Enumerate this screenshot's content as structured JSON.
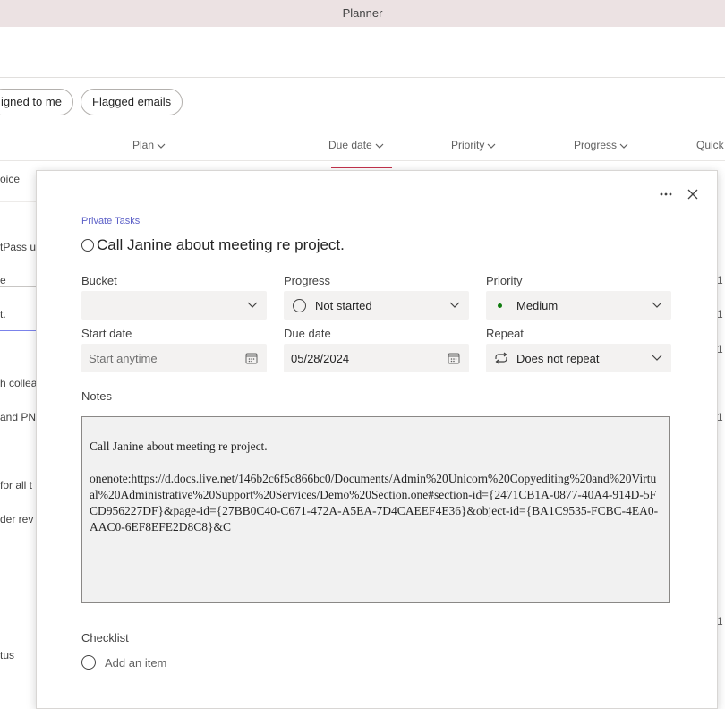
{
  "app": {
    "title": "Planner"
  },
  "filters": {
    "assigned_partial": "igned to me",
    "flagged": "Flagged emails"
  },
  "columns": {
    "plan": "Plan",
    "due_date": "Due date",
    "priority": "Priority",
    "progress": "Progress",
    "quick": "Quick"
  },
  "background_rows": [
    "oice",
    "tPass us",
    "e",
    "t.",
    "h collea",
    "and PN",
    "for all t",
    "der rev",
    "tus"
  ],
  "background_numbers": [
    "1",
    "1",
    "1",
    "1",
    "1"
  ],
  "task": {
    "plan_name": "Private Tasks",
    "title": "Call Janine about meeting re project.",
    "bucket": {
      "label": "Bucket",
      "value": ""
    },
    "progress": {
      "label": "Progress",
      "value": "Not started"
    },
    "priority": {
      "label": "Priority",
      "value": "Medium",
      "dot_color": "#107c10"
    },
    "start_date": {
      "label": "Start date",
      "placeholder": "Start anytime"
    },
    "due_date": {
      "label": "Due date",
      "value": "05/28/2024"
    },
    "repeat": {
      "label": "Repeat",
      "value": "Does not repeat"
    },
    "notes": {
      "label": "Notes",
      "line1": "Call Janine about meeting re project.",
      "line2": "onenote:https://d.docs.live.net/146b2c6f5c866bc0/Documents/Admin%20Unicorn%20Copyediting%20and%20Virtual%20Administrative%20Support%20Services/Demo%20Section.one#section-id={2471CB1A-0877-40A4-914D-5FCD956227DF}&page-id={27BB0C40-C671-472A-A5EA-7D4CAEEF4E36}&object-id={BA1C9535-FCBC-4EA0-AAC0-6EF8EFE2D8C8}&C"
    },
    "checklist": {
      "label": "Checklist",
      "add_placeholder": "Add an item"
    }
  },
  "icons": {
    "more": "more-icon",
    "close": "close-icon",
    "calendar": "calendar-icon",
    "repeat": "repeat-icon",
    "chevron": "chevron-down-icon"
  },
  "colors": {
    "accent": "#5b5fc7",
    "due_highlight": "#c4314b",
    "titlebar": "#ece2e3"
  }
}
